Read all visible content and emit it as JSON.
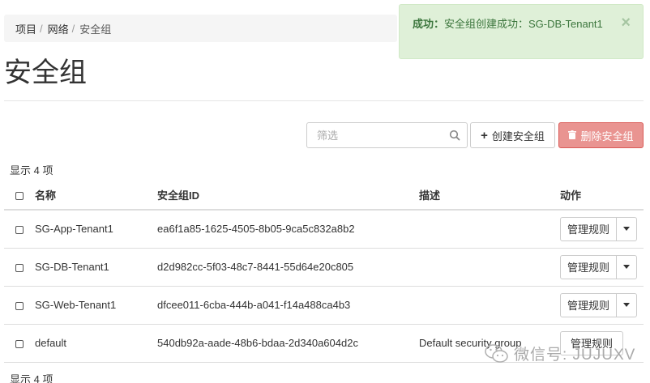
{
  "breadcrumb": {
    "items": [
      "项目",
      "网络"
    ],
    "current": "安全组"
  },
  "alert": {
    "prefix": "成功：",
    "message": "安全组创建成功：SG-DB-Tenant1",
    "close": "×"
  },
  "page": {
    "title": "安全组"
  },
  "toolbar": {
    "search_placeholder": "筛选",
    "create_label": "创建安全组",
    "delete_label": "删除安全组"
  },
  "table": {
    "count_top": "显示 4 项",
    "count_bottom": "显示 4 项",
    "headers": {
      "name": "名称",
      "id": "安全组ID",
      "desc": "描述",
      "actions": "动作"
    },
    "rows": [
      {
        "name": "SG-App-Tenant1",
        "id": "ea6f1a85-1625-4505-8b05-9ca5c832a8b2",
        "desc": "",
        "action": "管理规则"
      },
      {
        "name": "SG-DB-Tenant1",
        "id": "d2d982cc-5f03-48c7-8441-55d64e20c805",
        "desc": "",
        "action": "管理规则"
      },
      {
        "name": "SG-Web-Tenant1",
        "id": "dfcee011-6cba-444b-a041-f14a488ca4b3",
        "desc": "",
        "action": "管理规则"
      },
      {
        "name": "default",
        "id": "540db92a-aade-48b6-bdaa-2d340a604d2c",
        "desc": "Default security group",
        "action": "管理规则"
      }
    ]
  },
  "watermark": {
    "text": "微信号: JUJUXV"
  }
}
